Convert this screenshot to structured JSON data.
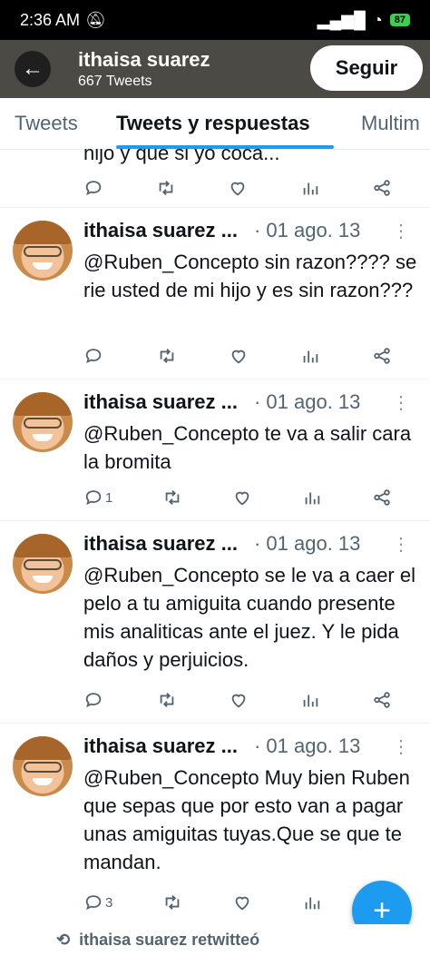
{
  "status": {
    "time": "2:36 AM",
    "battery": "87"
  },
  "header": {
    "name": "ithaisa suarez",
    "tweet_count": "667 Tweets",
    "follow_label": "Seguir"
  },
  "tabs": [
    {
      "label": "Tweets"
    },
    {
      "label": "Tweets y respuestas"
    },
    {
      "label": "Multim"
    }
  ],
  "partial_text": "hijo y que si yo coca...",
  "tweets": [
    {
      "name": "ithaisa suarez ...",
      "date": "· 01 ago. 13",
      "text": "@Ruben_Concepto sin razon???? se rie usted de mi hijo y es sin razon???",
      "replies": ""
    },
    {
      "name": "ithaisa suarez ...",
      "date": "· 01 ago. 13",
      "text": "@Ruben_Concepto te va a salir cara la bromita",
      "replies": "1"
    },
    {
      "name": "ithaisa suarez ...",
      "date": "· 01 ago. 13",
      "text": "@Ruben_Concepto se le va a caer el pelo a tu amiguita cuando presente mis analiticas ante el juez. Y le pida daños y perjuicios.",
      "replies": ""
    },
    {
      "name": "ithaisa suarez ...",
      "date": "· 01 ago. 13",
      "text": "@Ruben_Concepto Muy bien Ruben que sepas que por esto van a pagar unas amiguitas tuyas.Que se que te mandan.",
      "replies": "3"
    }
  ],
  "retweet_label": "ithaisa suarez retwitteó",
  "colors": {
    "accent": "#1d9bf0",
    "header_bg": "#4b4a45"
  }
}
